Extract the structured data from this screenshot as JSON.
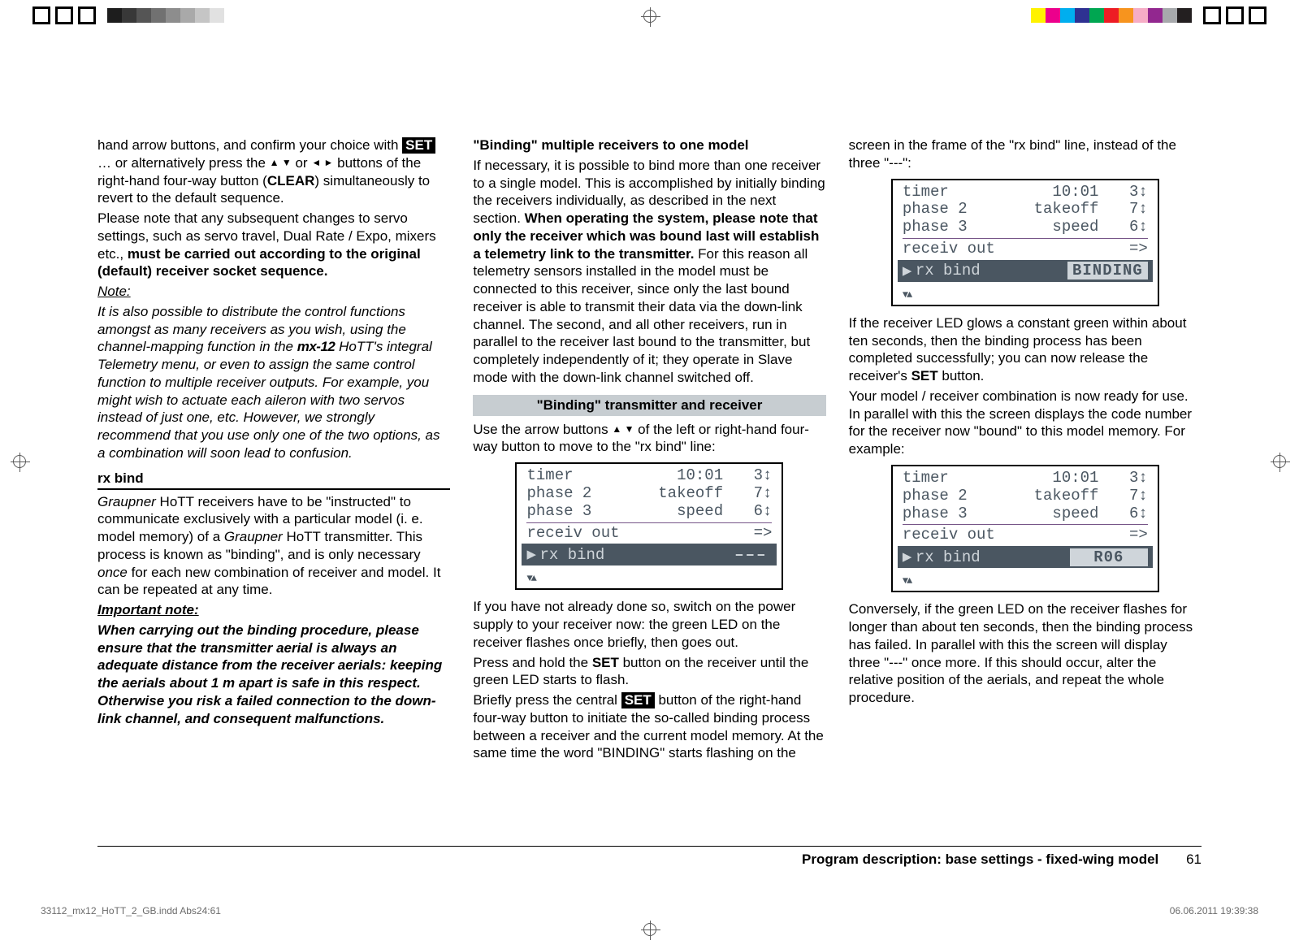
{
  "col1": {
    "p1_a": "hand arrow buttons, and confirm your choice with ",
    "set": "SET",
    "p1_b": " … or alternatively press the ",
    "arrows_ud": "▲ ▼",
    "or": " or ",
    "arrows_lr": "◄ ►",
    "p1_c": " buttons of the right-hand four-way button (",
    "clear": "CLEAR",
    "p1_d": ") simultaneously to revert to the default sequence.",
    "p2_a": "Please note that any subsequent changes to servo settings, such as servo travel, Dual Rate / Expo, mixers etc., ",
    "p2_bold": "must be carried out according to the original (default) receiver socket sequence.",
    "note_head": "Note:",
    "note_body_a": "It is also possible to distribute the control functions amongst as many receivers as you wish, using the channel-mapping function in the ",
    "mx12": "mx-12",
    "note_body_b": " HoTT's integral Telemetry menu, or even to assign the same control function to multiple receiver outputs. For example, you might wish to actuate each aileron with two servos instead of just one, etc. However, we strongly recommend that you use only one of the two options, as a combination will soon lead to confusion.",
    "rxbind_head": "rx bind",
    "rxbind_p1_a": "Graupner",
    "rxbind_p1_b": " HoTT receivers have to be \"instructed\" to communicate exclusively with a particular model (i. e. model memory) of a ",
    "rxbind_p1_c": "Graupner",
    "rxbind_p1_d": " HoTT transmitter. This process is known as \"binding\", and is only necessary ",
    "once": "once",
    "rxbind_p1_e": " for each new combination of receiver and model. It can be repeated at any time.",
    "imp_head": "Important note:",
    "imp_body": "When carrying out the binding procedure, please ensure that the transmitter aerial is always an adequate distance from the receiver aerials: keeping the aerials about 1 m apart is safe in this respect. Otherwise you risk a failed connection to the down-link channel, and consequent malfunctions."
  },
  "col2": {
    "h1": "\"Binding\" multiple receivers to one model",
    "p1": "If necessary, it is possible to bind more than one receiver to a single model. This is accomplished by initially binding the receivers individually, as described in the next section. ",
    "p1_bold": "When operating the system, please note that only the receiver which was bound last will establish a telemetry link to the transmitter.",
    "p1_b": " For this reason all telemetry sensors installed in the model must be connected to this receiver, since only the last bound receiver is able to transmit their data via the down-link channel. The second, and all other receivers, run in parallel to the receiver last bound to the transmitter, but completely independently of it; they operate in Slave mode with the down-link channel switched off.",
    "bar": "\"Binding\" transmitter and receiver",
    "p2_a": "Use the arrow buttons ",
    "arrows_ud": "▲ ▼",
    "p2_b": " of the left or right-hand four-way button to move to the \"rx bind\" line:",
    "p3": "If you have not already done so, switch on the power supply to your receiver now: the green LED on the receiver flashes once briefly, then goes out.",
    "p4_a": "Press and hold the ",
    "p4_set": "SET",
    "p4_b": " button on the receiver until the green LED starts to flash.",
    "p5_a": "Briefly press the central ",
    "p5_set": "SET",
    "p5_b": " button of the right-hand four-way button to initiate the so-called binding process between a receiver and the current model memory. At the same time the word \"BINDING\" starts flashing on the"
  },
  "col3": {
    "p1": "screen in the frame of the \"rx bind\" line, instead of the three \"---\":",
    "p2_a": "If the receiver LED glows a constant green within about ten seconds, then the binding process has been completed successfully; you can now release the receiver's ",
    "p2_set": "SET",
    "p2_b": " button.",
    "p3": "Your model / receiver combination is now ready for use. In parallel with this the screen displays the code number for the receiver now \"bound\" to this model memory. For example:",
    "p4": "Conversely, if the green LED on the receiver flashes for longer than about ten seconds, then the binding process has failed. In parallel with this the screen will display three \"---\" once more. If this should occur, alter the relative position of the aerials, and repeat the whole procedure."
  },
  "lcd": {
    "rows": [
      {
        "l": "timer",
        "m": "10:01",
        "r": "3↕"
      },
      {
        "l": "phase 2",
        "m": "takeoff",
        "r": "7↕"
      },
      {
        "l": "phase 3",
        "m": "speed",
        "r": "6↕"
      },
      {
        "l": "receiv out",
        "m": "",
        "r": "=>"
      }
    ],
    "sel_label": "rx  bind",
    "badge_dash": "–––",
    "badge_binding": "BINDING",
    "badge_r06": " R06 ",
    "foot": "▼▲"
  },
  "footer": {
    "title": "Program description: base settings - fixed-wing model",
    "page": "61"
  },
  "imprint": {
    "left": "33112_mx12_HoTT_2_GB.indd   Abs24:61",
    "right": "06.06.2011   19:39:38"
  },
  "swatches_gray": [
    "#1d1d1d",
    "#383838",
    "#555",
    "#717171",
    "#8d8d8d",
    "#a9a9a9",
    "#c5c5c5",
    "#e1e1e1",
    "#fff"
  ],
  "swatches_color": [
    "#ffffff",
    "#fff200",
    "#ec008c",
    "#00aeef",
    "#2e3192",
    "#00a651",
    "#ed1c24",
    "#f7941e",
    "#f6adc6",
    "#92278f",
    "#a7a9ac",
    "#231f20"
  ]
}
